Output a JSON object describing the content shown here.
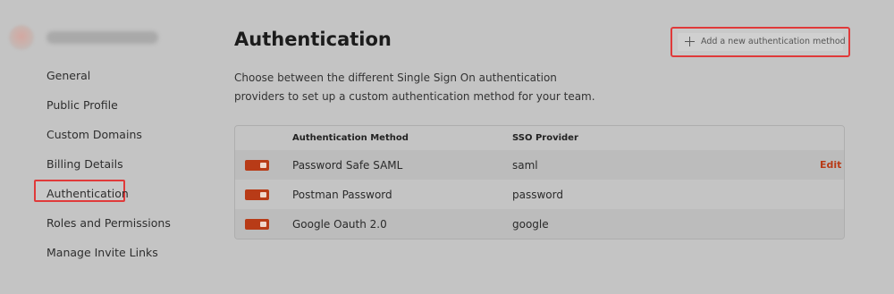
{
  "sidebar": {
    "items": [
      {
        "label": "General"
      },
      {
        "label": "Public Profile"
      },
      {
        "label": "Custom Domains"
      },
      {
        "label": "Billing Details"
      },
      {
        "label": "Authentication",
        "active": true
      },
      {
        "label": "Roles and Permissions"
      },
      {
        "label": "Manage Invite Links"
      }
    ]
  },
  "main": {
    "title": "Authentication",
    "description": "Choose between the different Single Sign On authentication providers to set up a custom authentication method for your team.",
    "add_button": {
      "label": "Add a new authentication method",
      "icon": "plus-icon"
    }
  },
  "table": {
    "headers": {
      "method": "Authentication Method",
      "provider": "SSO Provider"
    },
    "rows": [
      {
        "method": "Password Safe SAML",
        "provider": "saml",
        "enabled": true,
        "action": "Edit"
      },
      {
        "method": "Postman Password",
        "provider": "password",
        "enabled": true
      },
      {
        "method": "Google Oauth 2.0",
        "provider": "google",
        "enabled": true
      }
    ]
  },
  "colors": {
    "accent": "#b83b17",
    "highlight_border": "#e03a3a",
    "background": "#c4c4c4"
  }
}
